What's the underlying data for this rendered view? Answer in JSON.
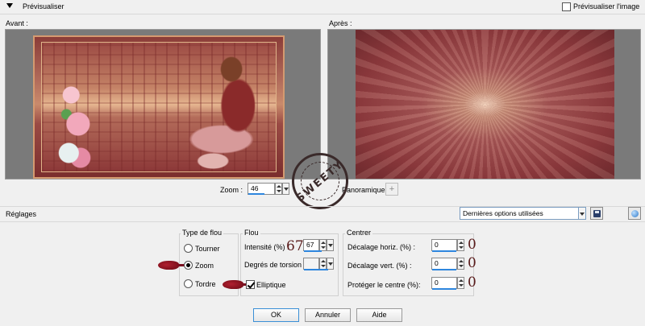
{
  "preview_header": {
    "title": "Prévisualiser",
    "preview_image_label": "Prévisualiser l'image",
    "preview_image_checked": false
  },
  "panes": {
    "before_label": "Avant :",
    "after_label": "Après :"
  },
  "zoom": {
    "label": "Zoom :",
    "value": "46",
    "pan_label": "Panoramique :"
  },
  "watermark": {
    "text": "SWEETY"
  },
  "settings": {
    "label": "Réglages",
    "preset_value": "Dernières options utilisées"
  },
  "blur_type": {
    "title": "Type de flou",
    "options": [
      {
        "label": "Tourner",
        "selected": false
      },
      {
        "label": "Zoom",
        "selected": true
      },
      {
        "label": "Tordre",
        "selected": false
      }
    ]
  },
  "blur": {
    "title": "Flou",
    "intensity_label": "Intensité (%) :",
    "intensity_value": "67",
    "intensity_annotation": "67",
    "torsion_label": "Degrés de torsion :",
    "torsion_value": "",
    "elliptical_label": "Elliptique",
    "elliptical_checked": true
  },
  "center": {
    "title": "Centrer",
    "h_offset_label": "Décalage horiz. (%) :",
    "h_offset_value": "0",
    "h_offset_annotation": "0",
    "v_offset_label": "Décalage vert. (%) :",
    "v_offset_value": "0",
    "v_offset_annotation": "0",
    "protect_label": "Protéger le centre (%):",
    "protect_value": "0",
    "protect_annotation": "0"
  },
  "buttons": {
    "ok": "OK",
    "cancel": "Annuler",
    "help": "Aide"
  },
  "colors": {
    "accent_blue": "#2e86de",
    "annotation_red": "#5a1c1c"
  }
}
